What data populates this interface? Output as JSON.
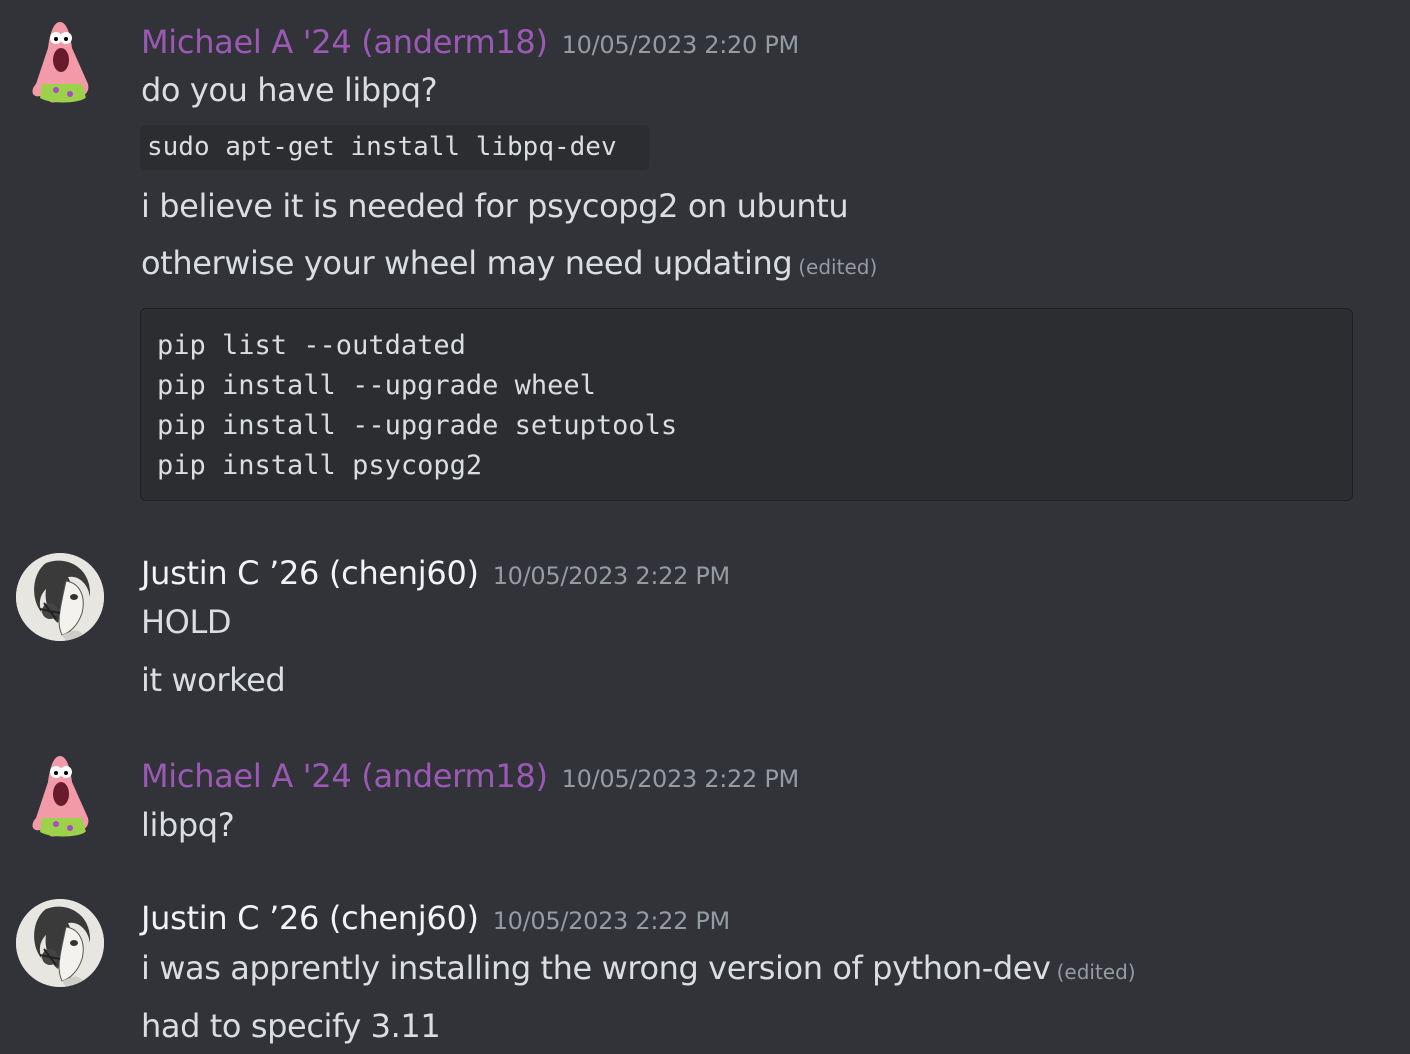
{
  "messages": [
    {
      "author": "Michael A '24 (anderm18)",
      "timestamp": "10/05/2023 2:20 PM",
      "avatar": "patrick-star-avatar",
      "color": "#9b59b6",
      "lines": [
        "do you have libpq?",
        "i believe it is needed for psycopg2 on ubuntu",
        "otherwise your wheel may need updating"
      ],
      "inline_code": "sudo apt-get install libpq-dev",
      "edited_label": "(edited)",
      "code_block": [
        "pip list --outdated",
        "pip install --upgrade wheel",
        "pip install --upgrade setuptools",
        "pip install psycopg2"
      ]
    },
    {
      "author": "Justin C ’26 (chenj60)",
      "timestamp": "10/05/2023 2:22 PM",
      "avatar": "anime-character-avatar",
      "lines": [
        "HOLD",
        "it worked"
      ]
    },
    {
      "author": "Michael A '24 (anderm18)",
      "timestamp": "10/05/2023 2:22 PM",
      "avatar": "patrick-star-avatar",
      "color": "#9b59b6",
      "lines": [
        "libpq?"
      ]
    },
    {
      "author": "Justin C ’26 (chenj60)",
      "timestamp": "10/05/2023 2:22 PM",
      "avatar": "anime-character-avatar",
      "lines": [
        "i was apprently installing the wrong version of python-dev",
        "had to specify 3.11"
      ],
      "edited_label": "(edited)"
    }
  ]
}
